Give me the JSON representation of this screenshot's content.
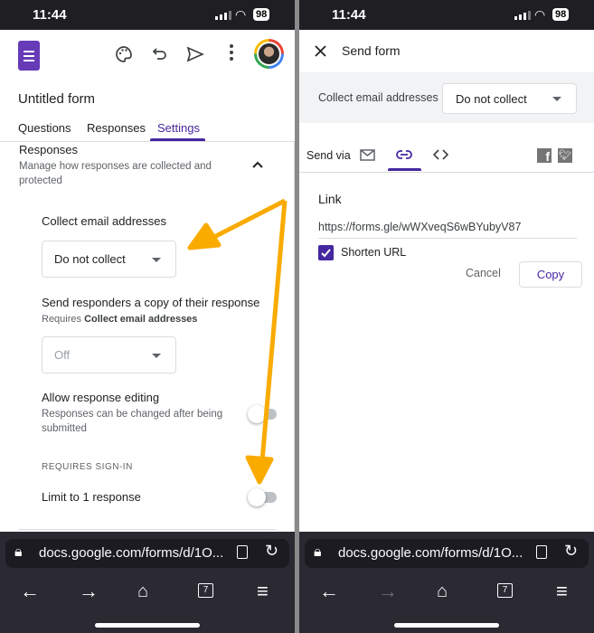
{
  "status_bar": {
    "time": "11:44",
    "battery": "98"
  },
  "left": {
    "form_title": "Untitled form",
    "tabs": [
      {
        "label": "Questions"
      },
      {
        "label": "Responses"
      },
      {
        "label": "Settings",
        "active": true
      }
    ],
    "section": {
      "title": "Responses",
      "subtitle_line1": "Manage how responses are collected and",
      "subtitle_line2": "protected"
    },
    "collect_email": {
      "label": "Collect email addresses",
      "value": "Do not collect"
    },
    "send_copy": {
      "label": "Send responders a copy of their response",
      "requires_prefix": "Requires ",
      "requires_bold": "Collect email addresses",
      "value": "Off"
    },
    "allow_editing": {
      "label": "Allow response editing",
      "sub1": "Responses can be changed after being",
      "sub2": "submitted",
      "enabled": false
    },
    "requires_signin": "REQUIRES SIGN-IN",
    "limit": {
      "label": "Limit to 1 response",
      "enabled": false
    }
  },
  "right": {
    "dialog_title": "Send form",
    "collect_label": "Collect email addresses",
    "collect_value": "Do not collect",
    "send_via": "Send via",
    "link_heading": "Link",
    "link_url": "https://forms.gle/wWXveqS6wBYubyV87",
    "shorten_label": "Shorten URL",
    "shorten_checked": true,
    "cancel": "Cancel",
    "copy": "Copy"
  },
  "browser": {
    "url": "docs.google.com/forms/d/1O...",
    "tab_count": "7"
  },
  "colors": {
    "accent": "#673ab7",
    "arrow": "#f9ab00"
  }
}
